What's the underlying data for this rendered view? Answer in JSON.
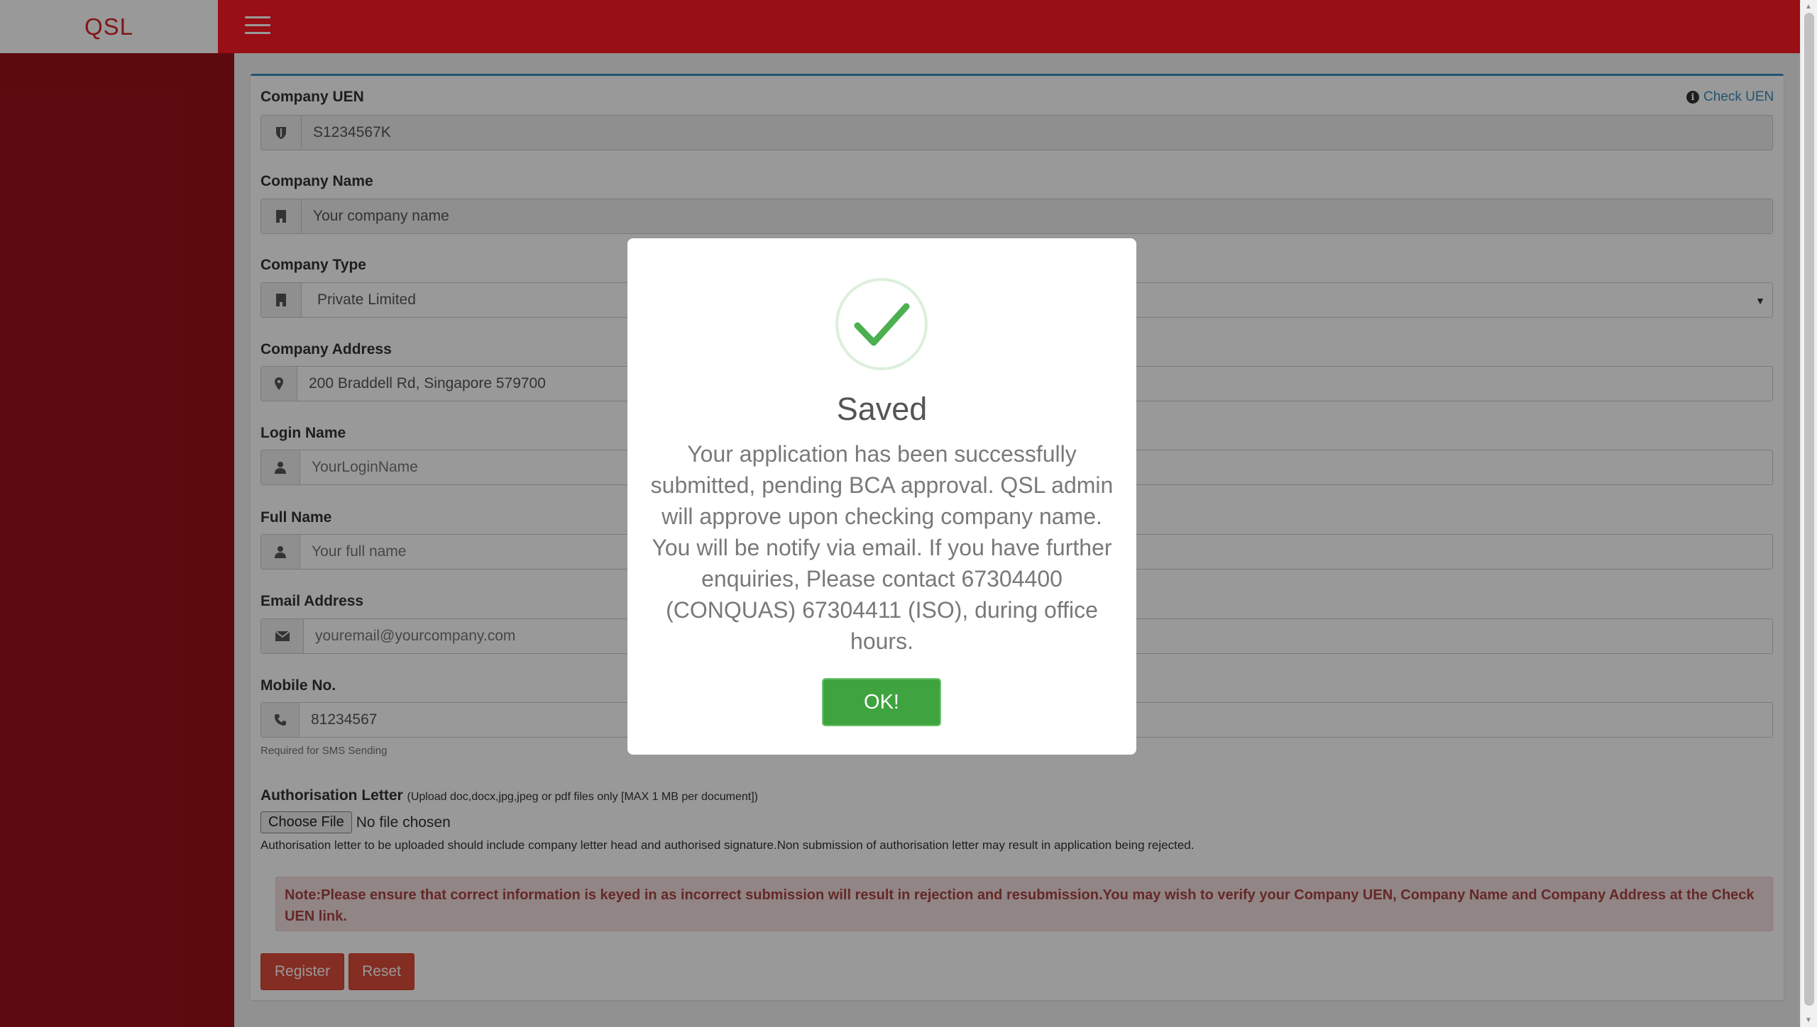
{
  "header": {
    "logo": "QSL"
  },
  "form": {
    "check_uen_label": "Check UEN",
    "uen": {
      "label": "Company UEN",
      "value": "S1234567K"
    },
    "company_name": {
      "label": "Company Name",
      "placeholder": "Your company name"
    },
    "company_type": {
      "label": "Company Type",
      "value": "Private Limited"
    },
    "company_address": {
      "label": "Company Address",
      "value": "200 Braddell Rd, Singapore 579700"
    },
    "login_name": {
      "label": "Login Name",
      "placeholder": "YourLoginName"
    },
    "full_name": {
      "label": "Full Name",
      "placeholder": "Your full name"
    },
    "email": {
      "label": "Email Address",
      "placeholder": "youremail@yourcompany.com"
    },
    "mobile": {
      "label": "Mobile No.",
      "placeholder": "81234567",
      "help": "Required for SMS Sending"
    },
    "auth_letter": {
      "label": "Authorisation Letter",
      "hint": "(Upload doc,docx,jpg,jpeg or pdf files only [MAX 1 MB per document])",
      "choose_file": "Choose File",
      "no_file": "No file chosen",
      "note": "Authorisation letter to be uploaded should include company letter head and authorised signature.Non submission of authorisation letter may result in application being rejected."
    },
    "alert": "Note:Please ensure that correct information is keyed in as incorrect submission will result in rejection and resubmission.You may wish to verify your Company UEN, Company Name and Company Address at the Check UEN link.",
    "register_label": "Register",
    "reset_label": "Reset"
  },
  "modal": {
    "title": "Saved",
    "message": "Your application has been successfully submitted, pending BCA approval. QSL admin will approve upon checking company name. You will be notify via email. If you have further enquiries, Please contact 67304400 (CONQUAS) 67304411 (ISO), during office hours.",
    "ok_label": "OK!",
    "success_color": "#4caf50"
  },
  "colors": {
    "topbar": "#fe1a23",
    "sidebar": "#9b111a",
    "accent": "#3c8dbc",
    "danger": "#dd4b39"
  }
}
